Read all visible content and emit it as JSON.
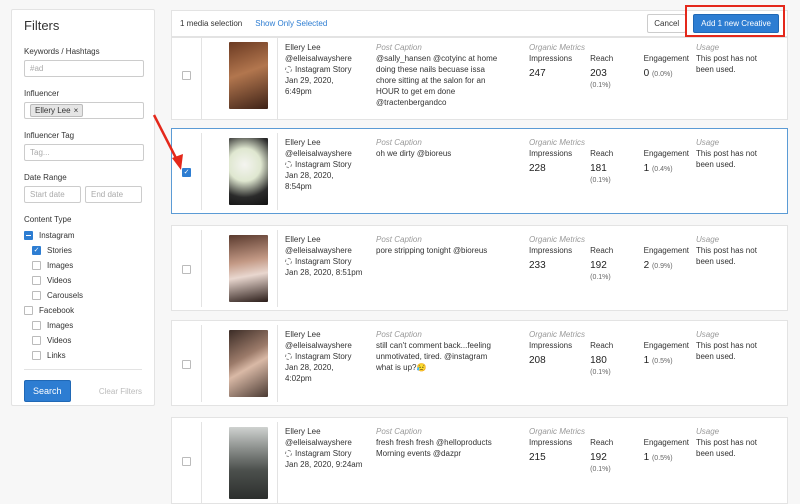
{
  "filters": {
    "title": "Filters",
    "keywords_label": "Keywords / Hashtags",
    "keywords_placeholder": "#ad",
    "influencer_label": "Influencer",
    "influencer_tag": "Ellery Lee",
    "influencer_tag_label": "Influencer Tag",
    "influencer_tag_placeholder": "Tag...",
    "date_range_label": "Date Range",
    "start_date_placeholder": "Start date",
    "end_date_placeholder": "End date",
    "content_type_label": "Content Type",
    "instagram": "Instagram",
    "stories": "Stories",
    "images": "Images",
    "videos": "Videos",
    "carousels": "Carousels",
    "facebook": "Facebook",
    "fb_images": "Images",
    "fb_videos": "Videos",
    "fb_links": "Links",
    "search_button": "Search",
    "clear_filters": "Clear Filters"
  },
  "topbar": {
    "selection_count": "1 media selection",
    "show_only_selected": "Show Only Selected",
    "cancel": "Cancel",
    "add_creative": "Add 1 new Creative"
  },
  "labels": {
    "post_caption": "Post Caption",
    "organic_metrics": "Organic Metrics",
    "impressions": "Impressions",
    "reach": "Reach",
    "engagement": "Engagement",
    "usage": "Usage"
  },
  "rows": [
    {
      "name": "Ellery Lee",
      "handle": "@elleisalwayshere",
      "type": "Instagram Story",
      "date": "Jan 29, 2020,",
      "time": "6:49pm",
      "caption": "@sally_hansen @cotyinc at home doing these nails becuase issa chore sitting at the salon for an HOUR to get em done @tractenbergandco",
      "impressions": "247",
      "reach": "203",
      "reach_pct": "(0.1%)",
      "engagement": "0",
      "engagement_pct": "(0.0%)",
      "usage": "This post has not been used."
    },
    {
      "name": "Ellery Lee",
      "handle": "@elleisalwayshere",
      "type": "Instagram Story",
      "date": "Jan 28, 2020,",
      "time": "8:54pm",
      "caption": "oh we dirty @bioreus",
      "impressions": "228",
      "reach": "181",
      "reach_pct": "(0.1%)",
      "engagement": "1",
      "engagement_pct": "(0.4%)",
      "usage": "This post has not been used."
    },
    {
      "name": "Ellery Lee",
      "handle": "@elleisalwayshere",
      "type": "Instagram Story",
      "date": "Jan 28, 2020, 8:51pm",
      "time": "",
      "caption": "pore stripping tonight @bioreus",
      "impressions": "233",
      "reach": "192",
      "reach_pct": "(0.1%)",
      "engagement": "2",
      "engagement_pct": "(0.9%)",
      "usage": "This post has not been used."
    },
    {
      "name": "Ellery Lee",
      "handle": "@elleisalwayshere",
      "type": "Instagram Story",
      "date": "Jan 28, 2020,",
      "time": "4:02pm",
      "caption": "still can't comment back...feeling unmotivated, tired. @instagram what is up?😥",
      "impressions": "208",
      "reach": "180",
      "reach_pct": "(0.1%)",
      "engagement": "1",
      "engagement_pct": "(0.5%)",
      "usage": "This post has not been used."
    },
    {
      "name": "Ellery Lee",
      "handle": "@elleisalwayshere",
      "type": "Instagram Story",
      "date": "Jan 28, 2020, 9:24am",
      "time": "",
      "caption": "fresh fresh fresh @helloproducts Morning events @dazpr",
      "impressions": "215",
      "reach": "192",
      "reach_pct": "(0.1%)",
      "engagement": "1",
      "engagement_pct": "(0.5%)",
      "usage": "This post has not been used."
    }
  ],
  "colors": {
    "accent": "#2d7dd2",
    "highlight": "#e4281b"
  }
}
